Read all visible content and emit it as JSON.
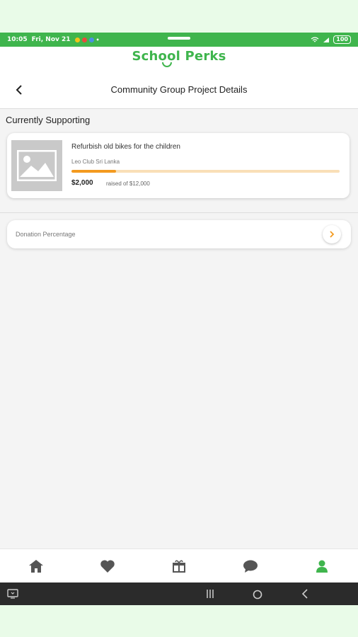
{
  "status_bar": {
    "time": "10:05",
    "date": "Fri, Nov 21",
    "battery": "100"
  },
  "brand": {
    "name": "School Perks",
    "color": "#3fb54d"
  },
  "header": {
    "title": "Community Group Project Details",
    "back_icon": "chevron-left-icon"
  },
  "section": {
    "title": "Currently Supporting"
  },
  "project": {
    "title": "Refurbish old bikes for the children",
    "organization": "Leo Club Sri Lanka",
    "amount": "$2,000",
    "raised_text": "raised of $12,000",
    "progress_percent": 16.7,
    "progress_color": "#f39a1f",
    "image_icon": "image-placeholder-icon"
  },
  "donation": {
    "label": "Donation Percentage",
    "arrow_icon": "chevron-right-icon",
    "arrow_color": "#f39a1f"
  },
  "bottom_nav": {
    "items": [
      {
        "icon": "home-icon",
        "active": false
      },
      {
        "icon": "heart-icon",
        "active": false
      },
      {
        "icon": "gift-icon",
        "active": false
      },
      {
        "icon": "chat-icon",
        "active": false
      },
      {
        "icon": "profile-icon",
        "active": true
      }
    ],
    "active_color": "#3fb54d",
    "inactive_color": "#555555"
  }
}
